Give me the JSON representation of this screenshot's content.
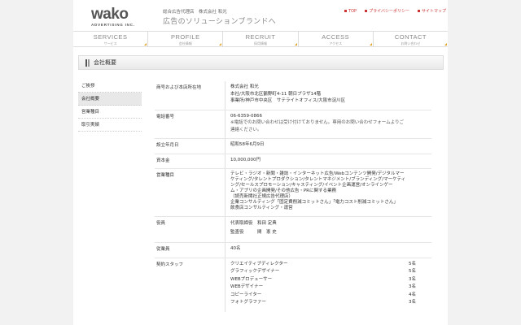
{
  "header": {
    "logo_main": "wako",
    "logo_sub": "ADVERTISING INC.",
    "tagline_small": "総合広告代理店　株式会社 和光",
    "tagline_main": "広告のソリューションブランドへ",
    "links": [
      "TOP",
      "プライバシーポリシー",
      "サイトマップ"
    ]
  },
  "nav": [
    {
      "en": "SERVICES",
      "jp": "サービス"
    },
    {
      "en": "PROFILE",
      "jp": "会社情報"
    },
    {
      "en": "RECRUIT",
      "jp": "採用情報"
    },
    {
      "en": "ACCESS",
      "jp": "アクセス"
    },
    {
      "en": "CONTACT",
      "jp": "お問い合わせ"
    }
  ],
  "page_title": "会社概要",
  "sidebar": [
    "ご挨拶",
    "会社概要",
    "営業種目",
    "取引実績"
  ],
  "table": {
    "name_label": "商号および本店所在地",
    "name_lines": [
      "株式会社 和光",
      "本社/大阪市北区鶴野町4-11 朝日プラザ14階",
      "事業所/神戸市中央区　サテライトオフィス/大阪市淀川区"
    ],
    "phone_label": "電話番号",
    "phone_lines": [
      "06-6359-0866",
      "※電話でのお問い合わせは受け付けておりません。専用のお問い合わせフォームよりご",
      "連絡ください。"
    ],
    "founded_label": "設立年月日",
    "founded": "昭和58年6月9日",
    "capital_label": "資本金",
    "capital": "10,000,000円",
    "business_label": "営業種目",
    "business_lines": [
      "テレビ・ラジオ・新聞・雑誌・インターネット広告/Webコンテンツ開発/デジタルマー",
      "ケティング/タレントプロダクション/タレントマネジメント/ブランディング/マーケティ",
      "ング/セールスプロモーション/キャスティング/イベント企画運営/オンラインゲー",
      "ム・アプリの企画開発/その他広告・PRに関する業務",
      "（読売新聞社正規広告代理店）",
      "企業コンサルティング「固定費削減コミットさん」「電力コスト削減コミットさん」",
      "飲食店コンサルティング・運営"
    ],
    "officers_label": "役員",
    "officers_lines": [
      "代表取締役　和田 定典",
      "監査役　　　間　憲 史"
    ],
    "employees_label": "従業員",
    "employees": "40名",
    "staff_label": "契約スタッフ",
    "staff": [
      {
        "role": "クリエイティブディレクター",
        "count": "5名"
      },
      {
        "role": "グラフィックデザイナー",
        "count": "5名"
      },
      {
        "role": "WEBプロデューサー",
        "count": "3名"
      },
      {
        "role": "WEBデザイナー",
        "count": "3名"
      },
      {
        "role": "コピーライター",
        "count": "4名"
      },
      {
        "role": "フォトグラファー",
        "count": "3名"
      }
    ]
  }
}
